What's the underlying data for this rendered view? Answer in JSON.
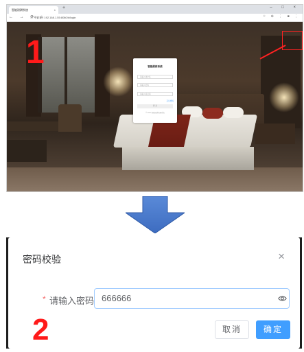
{
  "browser": {
    "tab_title": "智能耐耕系统",
    "tab_close": "×",
    "new_tab": "+",
    "window_controls": "– □ ×",
    "nav_buttons": "← → ⟳ ⌂",
    "url": "① 不安全 | 192.168.1.55:8080/#/login",
    "extension_icons": "☆ ⊕ ⋮ ■ ⋮"
  },
  "login_card": {
    "title": "智能耐耕系统",
    "username_placeholder": "请输入用户名",
    "password_placeholder": "请输入密码",
    "code_placeholder": "请输入验证码",
    "remember": "忘记密码",
    "submit": "登 录",
    "footer": "© 2021 智能耐耕管理系统"
  },
  "markers": {
    "first": "1",
    "second": "2"
  },
  "dialog": {
    "title": "密码校验",
    "close": "×",
    "required_mark": "*",
    "password_label": "请输入密码:",
    "password_value": "666666",
    "cancel_label": "取消",
    "confirm_label": "确定"
  },
  "colors": {
    "primary": "#409eff",
    "marker_red": "#ff1a1a",
    "arrow_blue": "#4472c4"
  },
  "icons": {
    "arrow": "arrow-down-icon",
    "eye": "eye-icon",
    "close": "close-icon"
  }
}
